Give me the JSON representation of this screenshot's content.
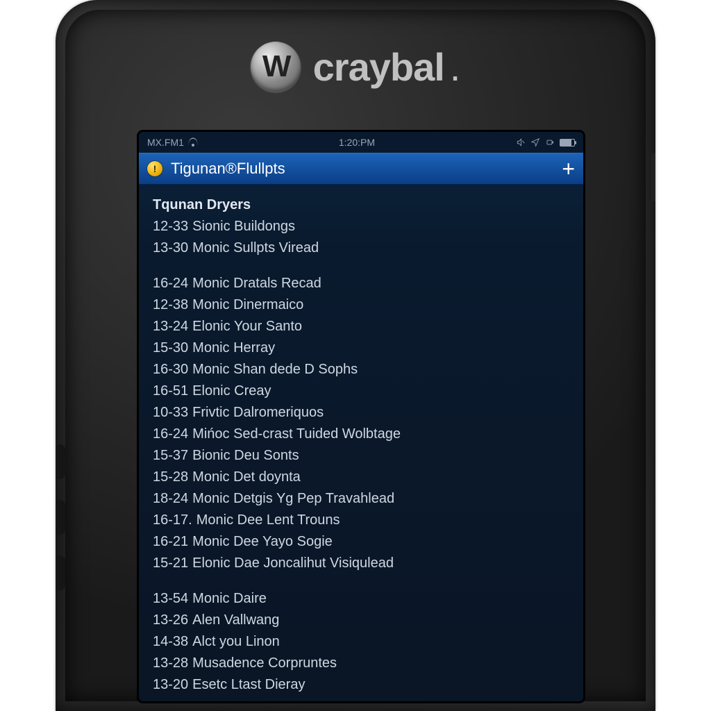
{
  "brand": {
    "logo_letter": "W",
    "name": "craybal",
    "dot": "."
  },
  "status": {
    "carrier": "MX.FM1",
    "time": "1:20:PM"
  },
  "header": {
    "warn_glyph": "!",
    "title": "Tigunan®Flullpts",
    "plus": "+"
  },
  "body": {
    "group1_head": "Tqunan Dryers",
    "group1": [
      {
        "code": "12-33",
        "text": "Sionic Buildongs"
      },
      {
        "code": "13-30",
        "text": "Monic Sullpts Viread"
      }
    ],
    "group2": [
      {
        "code": "16-24",
        "text": "Monic Dratals Recad"
      },
      {
        "code": "12-38",
        "text": "Monic Dinermaico"
      },
      {
        "code": "13-24",
        "text": "Elonic Your Santo"
      },
      {
        "code": "15-30",
        "text": "Monic Herray"
      },
      {
        "code": "16-30",
        "text": "Monic Shan dede D Sophs"
      },
      {
        "code": "16-51",
        "text": "Elonic Creay"
      },
      {
        "code": "10-33",
        "text": "Frivtic Dalromeriquos"
      },
      {
        "code": "16-24",
        "text": "Mińoc Sed-crast Tuided Wolbtage"
      },
      {
        "code": "15-37",
        "text": "Bionic Deu Sonts"
      },
      {
        "code": "15-28",
        "text": "Monic Det doynta"
      },
      {
        "code": "18-24",
        "text": "Monic Detgis Yg Pep Travahlead"
      },
      {
        "code": "16-17.",
        "text": "Monic Dee Lent Trouns"
      },
      {
        "code": "16-21",
        "text": "Monic Dee Yayo Sogie"
      },
      {
        "code": "15-21",
        "text": "Elonic Dae Joncalihut Visiqulead"
      }
    ],
    "group3": [
      {
        "code": "13-54",
        "text": "Monic Daire"
      },
      {
        "code": "13-26",
        "text": "Alen Vallwang"
      },
      {
        "code": "14-38",
        "text": "Alct you Linon"
      },
      {
        "code": "13-28",
        "text": "Musadence Corpruntes"
      },
      {
        "code": "13-20",
        "text": "Esetc Ltast Dieray"
      }
    ]
  }
}
